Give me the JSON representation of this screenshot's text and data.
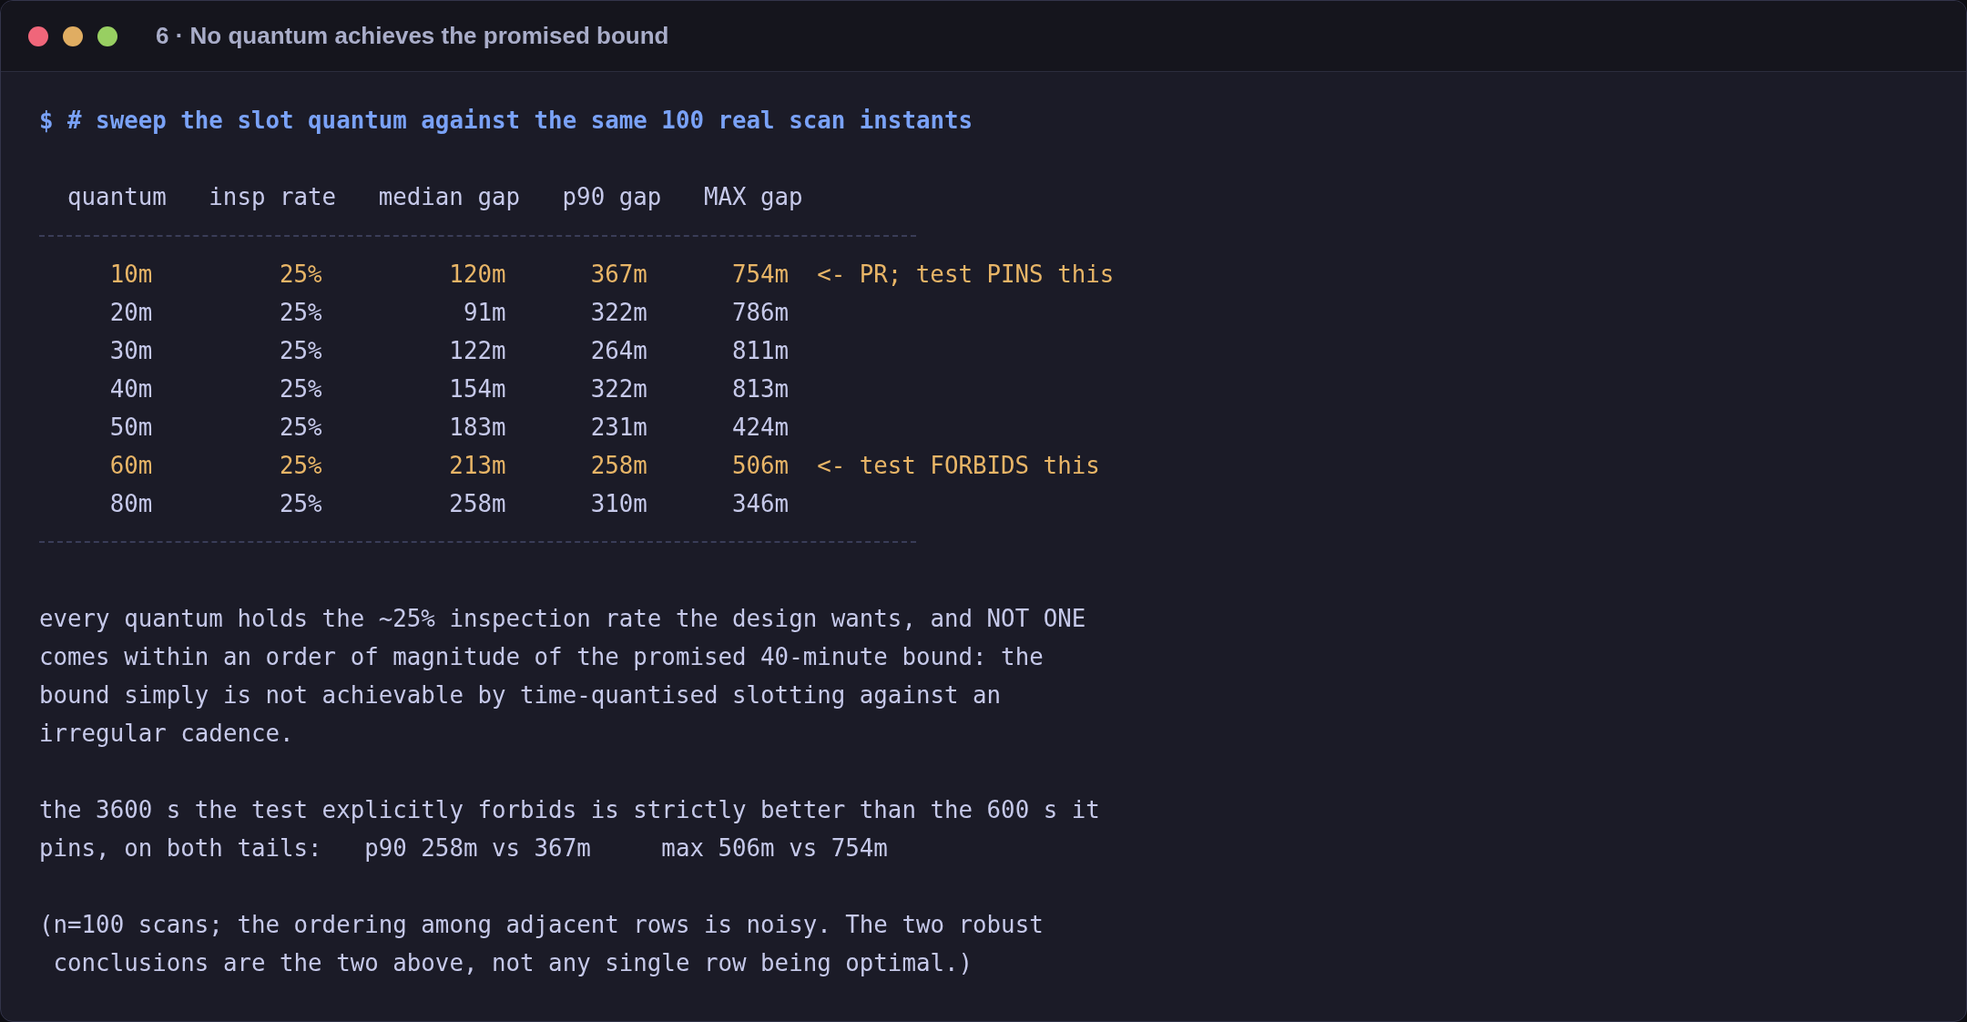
{
  "window": {
    "title": "6 · No quantum achieves the promised bound"
  },
  "command": "$ # sweep the slot quantum against the same 100 real scan instants",
  "table": {
    "columns": [
      "quantum",
      "insp rate",
      "median gap",
      "p90 gap",
      "MAX gap"
    ],
    "rows": [
      {
        "cells": [
          "10m",
          "25%",
          "120m",
          "367m",
          "754m"
        ],
        "highlighted": true,
        "note": "<- PR; test PINS this"
      },
      {
        "cells": [
          "20m",
          "25%",
          "91m",
          "322m",
          "786m"
        ],
        "highlighted": false
      },
      {
        "cells": [
          "30m",
          "25%",
          "122m",
          "264m",
          "811m"
        ],
        "highlighted": false
      },
      {
        "cells": [
          "40m",
          "25%",
          "154m",
          "322m",
          "813m"
        ],
        "highlighted": false
      },
      {
        "cells": [
          "50m",
          "25%",
          "183m",
          "231m",
          "424m"
        ],
        "highlighted": false
      },
      {
        "cells": [
          "60m",
          "25%",
          "213m",
          "258m",
          "506m"
        ],
        "highlighted": true,
        "note": "<- test FORBIDS this"
      },
      {
        "cells": [
          "80m",
          "25%",
          "258m",
          "310m",
          "346m"
        ],
        "highlighted": false
      }
    ]
  },
  "paragraphs": [
    "every quantum holds the ~25% inspection rate the design wants, and NOT ONE\ncomes within an order of magnitude of the promised 40-minute bound: the\nbound simply is not achievable by time-quantised slotting against an\nirregular cadence.",
    "the 3600 s the test explicitly forbids is strictly better than the 600 s it\npins, on both tails:   p90 258m vs 367m     max 506m vs 754m",
    "(n=100 scans; the ordering among adjacent rows is noisy. The two robust\n conclusions are the two above, not any single row being optimal.)"
  ]
}
